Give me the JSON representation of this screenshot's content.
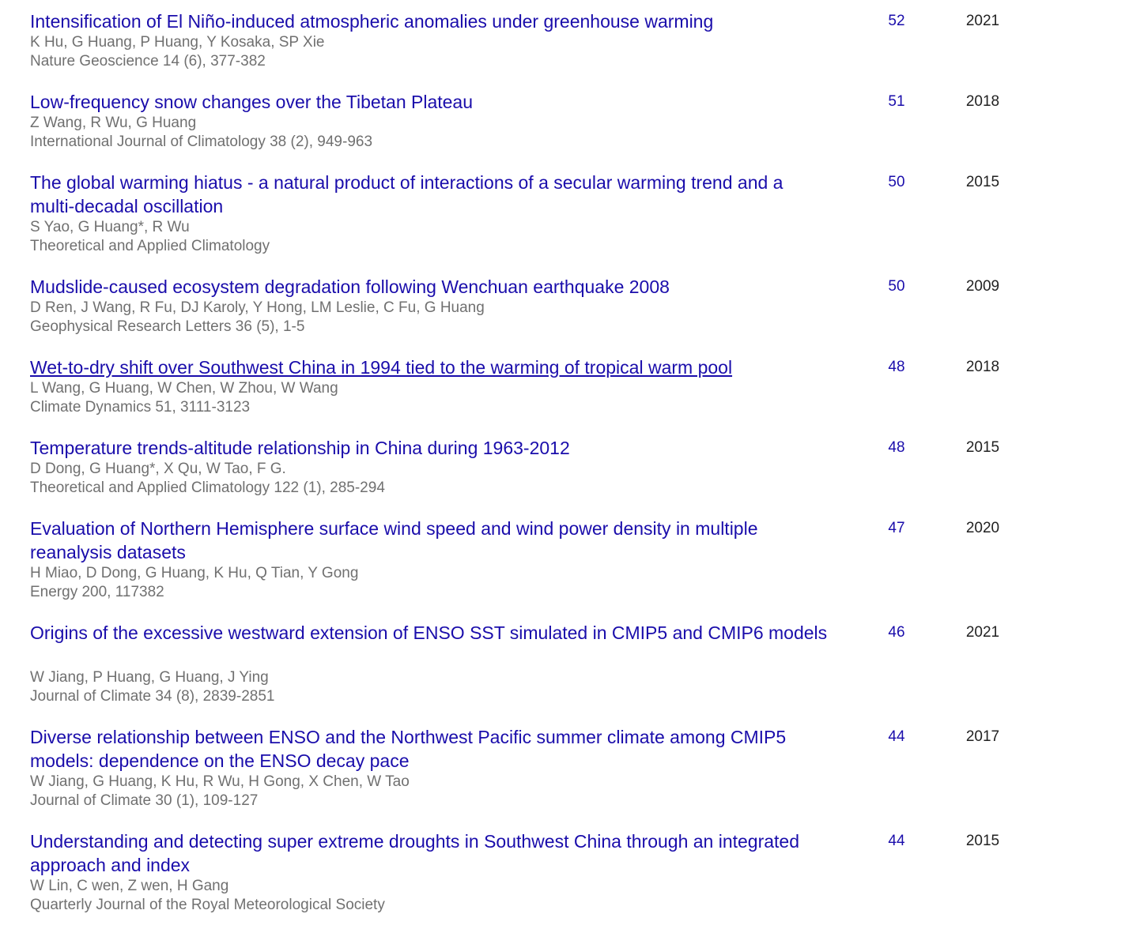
{
  "colors": {
    "link": "#1a0dab",
    "meta_text": "#707070",
    "year_text": "#222222",
    "background": "#ffffff"
  },
  "articles": [
    {
      "title": "Intensification of El Niño-induced atmospheric anomalies under greenhouse warming",
      "authors": "K Hu, G Huang, P Huang, Y Kosaka, SP Xie",
      "venue": "Nature Geoscience 14 (6), 377-382",
      "cited_by": "52",
      "year": "2021"
    },
    {
      "title": "Low-frequency snow changes over the Tibetan Plateau",
      "authors": "Z Wang, R Wu, G Huang",
      "venue": "International Journal of Climatology 38 (2), 949-963",
      "cited_by": "51",
      "year": "2018"
    },
    {
      "title": "The global warming hiatus - a natural product of interactions of a secular warming trend and a multi-decadal oscillation",
      "authors": "S Yao, G Huang*, R Wu",
      "venue": "Theoretical and Applied Climatology",
      "cited_by": "50",
      "year": "2015"
    },
    {
      "title": "Mudslide-caused ecosystem degradation following Wenchuan earthquake 2008",
      "authors": "D Ren, J Wang, R Fu, DJ Karoly, Y Hong, LM Leslie, C Fu, G Huang",
      "venue": "Geophysical Research Letters 36 (5), 1-5",
      "cited_by": "50",
      "year": "2009"
    },
    {
      "title": "Wet-to-dry shift over Southwest China in 1994 tied to the warming of tropical warm pool",
      "authors": "L Wang, G Huang, W Chen, W Zhou, W Wang",
      "venue": "Climate Dynamics 51, 3111-3123",
      "cited_by": "48",
      "year": "2018",
      "hovered": true
    },
    {
      "title": "Temperature trends-altitude relationship in China during 1963-2012",
      "authors": "D Dong, G Huang*, X Qu, W Tao, F G.",
      "venue": "Theoretical and Applied Climatology 122 (1), 285-294",
      "cited_by": "48",
      "year": "2015"
    },
    {
      "title": "Evaluation of Northern Hemisphere surface wind speed and wind power density in multiple reanalysis datasets",
      "authors": "H Miao, D Dong, G Huang, K Hu, Q Tian, Y Gong",
      "venue": "Energy 200, 117382",
      "cited_by": "47",
      "year": "2020"
    },
    {
      "title": "Origins of the excessive westward extension of ENSO SST simulated in CMIP5 and CMIP6 models",
      "authors": "W Jiang, P Huang, G Huang, J Ying",
      "venue": "Journal of Climate 34 (8), 2839-2851",
      "cited_by": "46",
      "year": "2021"
    },
    {
      "title": "Diverse relationship between ENSO and the Northwest Pacific summer climate among CMIP5 models: dependence on the ENSO decay pace",
      "authors": "W Jiang, G Huang, K Hu, R Wu, H Gong, X Chen, W Tao",
      "venue": "Journal of Climate 30 (1), 109-127",
      "cited_by": "44",
      "year": "2017"
    },
    {
      "title": "Understanding and detecting super extreme droughts in Southwest China through an integrated approach and index",
      "authors": "W Lin, C wen, Z wen, H Gang",
      "venue": "Quarterly Journal of the Royal Meteorological Society",
      "cited_by": "44",
      "year": "2015"
    }
  ]
}
